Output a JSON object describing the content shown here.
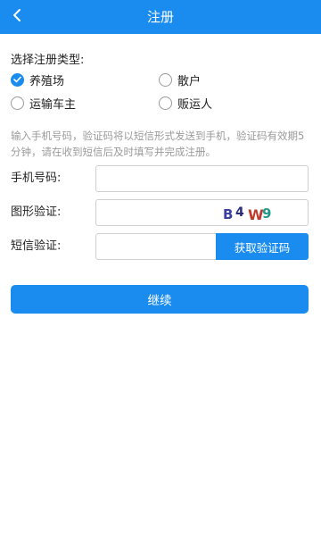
{
  "header": {
    "title": "注册",
    "back_icon": "chevron-left-icon"
  },
  "registration_type": {
    "label": "选择注册类型:",
    "options": [
      {
        "label": "养殖场",
        "checked": true
      },
      {
        "label": "散户",
        "checked": false
      },
      {
        "label": "运输车主",
        "checked": false
      },
      {
        "label": "贩运人",
        "checked": false
      }
    ]
  },
  "hint": "输入手机号码，验证码将以短信形式发送到手机，验证码有效期5分钟，请在收到短信后及时填写并完成注册。",
  "form": {
    "phone_label": "手机号码:",
    "phone_value": "",
    "image_code_label": "图形验证:",
    "image_code_value": "",
    "captcha_text": "B4W9",
    "sms_code_label": "短信验证:",
    "sms_code_value": "",
    "get_code_label": "获取验证码"
  },
  "continue_label": "继续",
  "colors": {
    "accent": "#1a8cf0"
  }
}
